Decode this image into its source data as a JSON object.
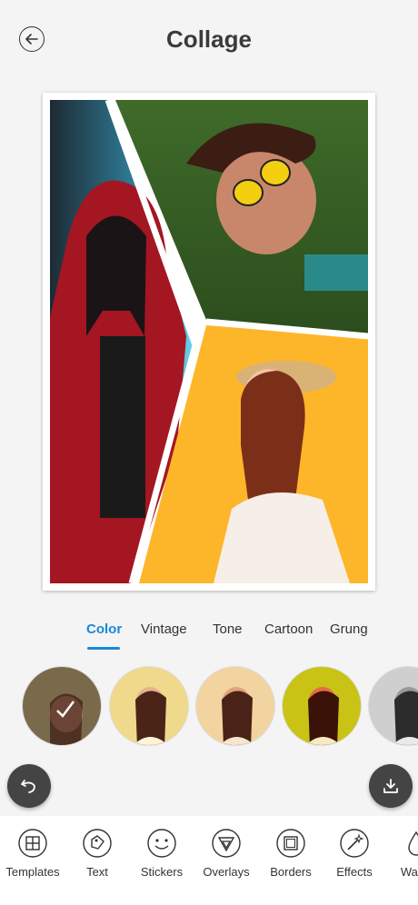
{
  "header": {
    "title": "Collage"
  },
  "filter_tabs": [
    {
      "label": "Color",
      "active": true
    },
    {
      "label": "Vintage"
    },
    {
      "label": "Tone"
    },
    {
      "label": "Cartoon"
    },
    {
      "label": "Grung"
    }
  ],
  "filters": [
    {
      "name": "color-original",
      "selected": true
    },
    {
      "name": "vintage-1"
    },
    {
      "name": "vintage-2"
    },
    {
      "name": "vintage-3"
    },
    {
      "name": "mono"
    }
  ],
  "toolbar": [
    {
      "label": "Templates",
      "icon": "templates-icon"
    },
    {
      "label": "Text",
      "icon": "text-tag-icon"
    },
    {
      "label": "Stickers",
      "icon": "smiley-icon"
    },
    {
      "label": "Overlays",
      "icon": "overlay-triangle-icon"
    },
    {
      "label": "Borders",
      "icon": "border-square-icon"
    },
    {
      "label": "Effects",
      "icon": "magic-wand-icon"
    },
    {
      "label": "Water",
      "icon": "water-drop-icon"
    }
  ],
  "colors": {
    "accent": "#1a87d9",
    "float_button": "#444444"
  }
}
